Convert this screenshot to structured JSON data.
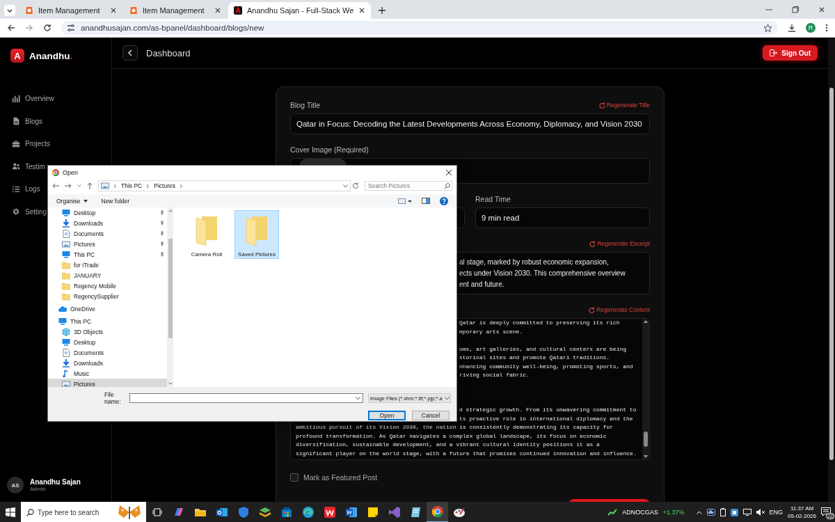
{
  "browser": {
    "tabs": [
      {
        "title": "Item Management",
        "selected": false
      },
      {
        "title": "Item Management",
        "selected": false
      },
      {
        "title": "Anandhu Sajan - Full-Stack We",
        "selected": true
      }
    ],
    "url": "anandhusajan.com/as-bpanel/dashboard/blogs/new",
    "profile_initial": "R"
  },
  "sidebar": {
    "logo_mark": "A",
    "brand": "Anandhu",
    "brand_dot": ".",
    "items": [
      {
        "label": "Overview",
        "kind": "chart"
      },
      {
        "label": "Blogs",
        "kind": "file"
      },
      {
        "label": "Projects",
        "kind": "briefcase"
      },
      {
        "label": "Testim",
        "kind": "users"
      },
      {
        "label": "Logs",
        "kind": "list"
      },
      {
        "label": "Setting",
        "kind": "gear"
      }
    ],
    "user": {
      "initials": "AS",
      "name": "Anandhu Sajan",
      "role": "Admin"
    }
  },
  "header": {
    "title": "Dashboard",
    "sign_out": "Sign Out"
  },
  "form": {
    "title_field": {
      "label": "Blog Title",
      "action": "Regenerate Title",
      "value": "Qatar in Focus: Decoding the Latest Developments Across Economy, Diplomacy, and Vision 2030"
    },
    "cover": {
      "label": "Cover Image (Required)"
    },
    "read_time": {
      "label": "Read Time",
      "value": "9 min read"
    },
    "excerpt": {
      "action": "Regenerate Excerpt",
      "lines": [
        {
          "text": "al stage, marked by robust economic expansion,",
          "partial": true
        },
        {
          "text": "ects under Vision 2030. This comprehensive overview",
          "partial": true
        },
        {
          "text": "ent and future.",
          "partial": true
        }
      ]
    },
    "content": {
      "action": "Regenerate Content",
      "lines": [
        {
          "kind": "text",
          "text": "Qatar is deeply committed to preserving its rich",
          "partial": true
        },
        {
          "kind": "text",
          "text": "mporary arts scene.",
          "partial": true
        },
        {
          "kind": "blank"
        },
        {
          "kind": "text",
          "text": "ums, art galleries, and cultural centers are being",
          "partial": true
        },
        {
          "kind": "text",
          "text": "storical sites and promote Qatari traditions.",
          "partial": true
        },
        {
          "kind": "text",
          "text": "nhancing community well-being, promoting sports, and",
          "partial": true
        },
        {
          "kind": "text",
          "text": "riving social fabric.",
          "partial": true
        },
        {
          "kind": "blank"
        },
        {
          "kind": "blank"
        },
        {
          "kind": "blank"
        },
        {
          "kind": "text",
          "text": "d strategic growth. From its unwavering commitment to",
          "partial": true
        },
        {
          "kind": "text",
          "text": "ts proactive role in international diplomacy and the",
          "partial": true
        },
        {
          "kind": "text",
          "text": "ambitious pursuit of its Vision 2030, the nation is consistently demonstrating its capacity for",
          "partial": false
        },
        {
          "kind": "text",
          "text": "profound transformation. As Qatar navigates a complex global landscape, its focus on economic",
          "partial": false
        },
        {
          "kind": "text",
          "text": "diversification, sustainable development, and a vibrant cultural identity positions it as a",
          "partial": false
        },
        {
          "kind": "text",
          "text": "significant player on the world stage, with a future that promises continued innovation and influence.",
          "partial": false
        }
      ]
    },
    "featured": {
      "label": "Mark as Featured Post",
      "checked": false
    }
  },
  "dialog": {
    "title": "Open",
    "path": [
      "This PC",
      "Pictures"
    ],
    "search_placeholder": "Search Pictures",
    "organise": "Organise",
    "new_folder": "New folder",
    "quick_access": [
      {
        "label": "Desktop",
        "kind": "desktop",
        "pinned": true,
        "selected": false
      },
      {
        "label": "Downloads",
        "kind": "download",
        "pinned": true,
        "selected": false
      },
      {
        "label": "Documents",
        "kind": "document",
        "pinned": true,
        "selected": false
      },
      {
        "label": "Pictures",
        "kind": "pictures",
        "pinned": true,
        "selected": false
      },
      {
        "label": "This PC",
        "kind": "desktop",
        "pinned": true,
        "selected": false
      },
      {
        "label": "for iTrade",
        "kind": "folder",
        "pinned": false,
        "selected": false
      },
      {
        "label": "JANUARY",
        "kind": "folder",
        "pinned": false,
        "selected": false
      },
      {
        "label": "Regency Mobile",
        "kind": "folder",
        "pinned": false,
        "selected": false
      },
      {
        "label": "RegencySupplier",
        "kind": "folder",
        "pinned": false,
        "selected": false
      }
    ],
    "tree": [
      {
        "label": "OneDrive",
        "kind": "cloud",
        "selected": false
      },
      {
        "label": "This PC",
        "kind": "desktop",
        "selected": false,
        "children": [
          {
            "label": "3D Objects",
            "kind": "cube",
            "selected": false
          },
          {
            "label": "Desktop",
            "kind": "desktop",
            "selected": false
          },
          {
            "label": "Documents",
            "kind": "document",
            "selected": false
          },
          {
            "label": "Downloads",
            "kind": "download",
            "selected": false
          },
          {
            "label": "Music",
            "kind": "music",
            "selected": false
          },
          {
            "label": "Pictures",
            "kind": "pictures",
            "selected": true
          }
        ]
      }
    ],
    "folders": [
      {
        "label": "Camera Roll",
        "selected": false
      },
      {
        "label": "Saved Pictures",
        "selected": true
      }
    ],
    "file_name_label": "File name:",
    "file_type": "Image Files (*.xbm;*.tif;*.pjp;*.a",
    "open": "Open",
    "cancel": "Cancel"
  },
  "taskbar": {
    "search_placeholder": "Type here to search",
    "apps": [
      {
        "kind": "copilot",
        "selected": false
      },
      {
        "kind": "explorer",
        "selected": false
      },
      {
        "kind": "outlook",
        "selected": false
      },
      {
        "kind": "shield",
        "selected": false
      },
      {
        "kind": "layers",
        "selected": false
      },
      {
        "kind": "store",
        "selected": false
      },
      {
        "kind": "edge",
        "selected": false
      },
      {
        "kind": "wps",
        "selected": false
      },
      {
        "kind": "word",
        "selected": false
      },
      {
        "kind": "sticky",
        "selected": false
      },
      {
        "kind": "vs",
        "selected": false
      },
      {
        "kind": "notepad",
        "selected": false
      },
      {
        "kind": "chrome",
        "selected": true
      },
      {
        "kind": "paint",
        "selected": false
      }
    ],
    "stock": {
      "name": "ADNOCGAS",
      "change": "+1.37%"
    },
    "language": "ENG",
    "time": "11:37 AM",
    "date": "05-02-2026",
    "notifications": "22"
  }
}
